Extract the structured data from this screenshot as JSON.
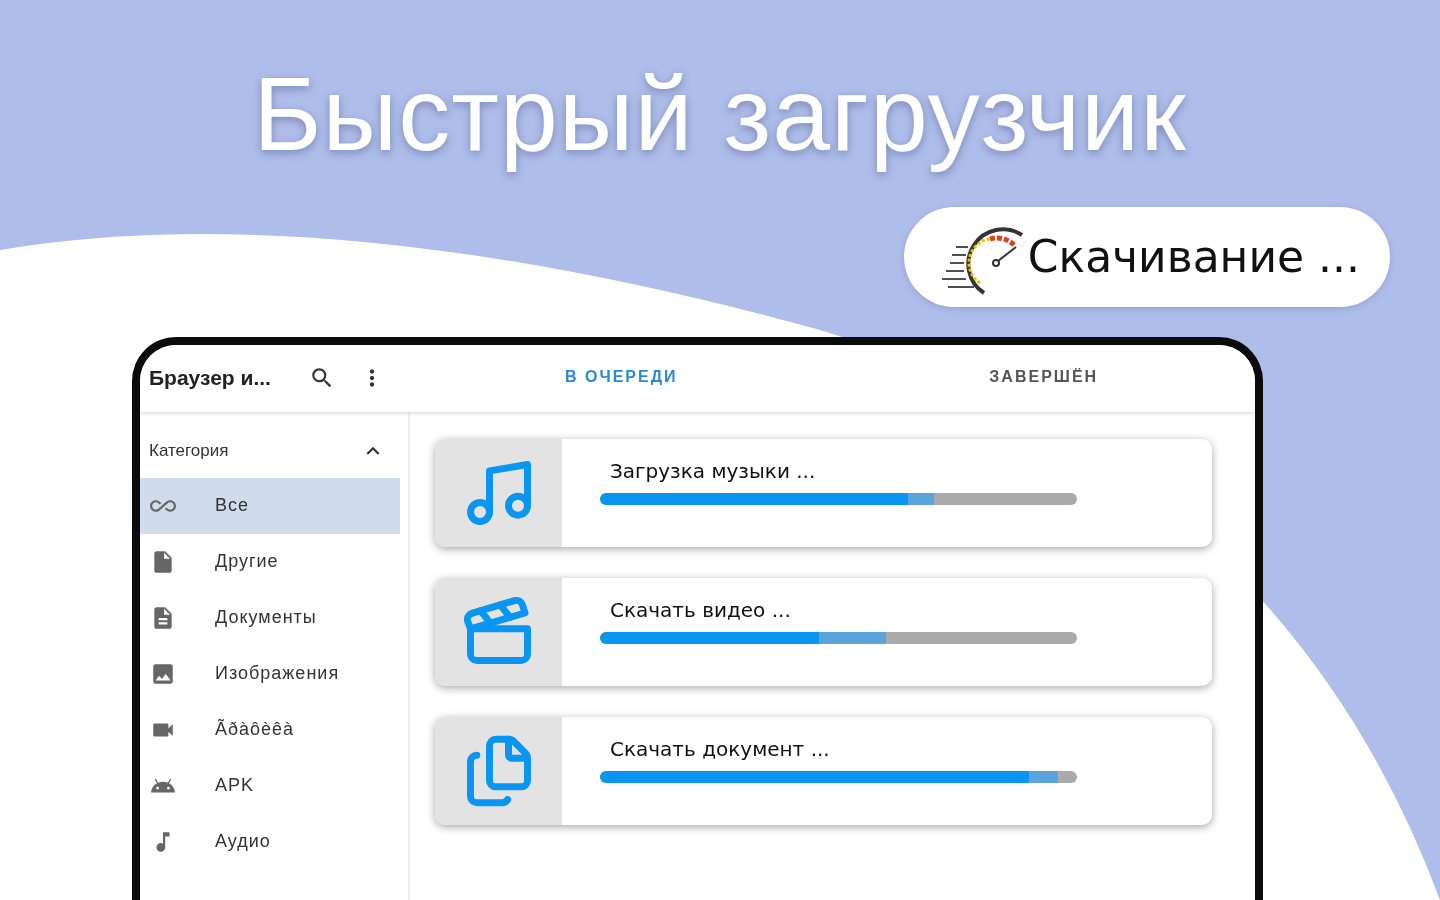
{
  "headline": "Быстрый загрузчик",
  "badge": {
    "label": "Скачивание ..."
  },
  "app": {
    "title": "Браузер и...",
    "tabs": [
      {
        "label": "В ОЧЕРЕДИ",
        "selected": true
      },
      {
        "label": "ЗАВЕРШЁН",
        "selected": false
      }
    ],
    "sidebar": {
      "heading": "Категория",
      "expanded": true,
      "items": [
        {
          "kind": "all",
          "label": "Все",
          "selected": true
        },
        {
          "kind": "other",
          "label": "Другие",
          "selected": false
        },
        {
          "kind": "documents",
          "label": "Документы",
          "selected": false
        },
        {
          "kind": "images",
          "label": "Изображения",
          "selected": false
        },
        {
          "kind": "video",
          "label": "Ãðàôèêà",
          "selected": false
        },
        {
          "kind": "apk",
          "label": "APK",
          "selected": false
        },
        {
          "kind": "audio",
          "label": "Аудио",
          "selected": false
        }
      ]
    },
    "downloads": [
      {
        "kind": "music",
        "title": "Загрузка музыки ...",
        "progress": {
          "level": 0.645
        },
        "buffer": {
          "level": 0.7
        }
      },
      {
        "kind": "video",
        "title": "Скачать видео ...",
        "progress": {
          "level": 0.46
        },
        "buffer": {
          "level": 0.6
        }
      },
      {
        "kind": "document",
        "title": "Скачать документ ...",
        "progress": {
          "level": 0.9
        },
        "buffer": {
          "level": 0.96
        }
      }
    ]
  }
}
